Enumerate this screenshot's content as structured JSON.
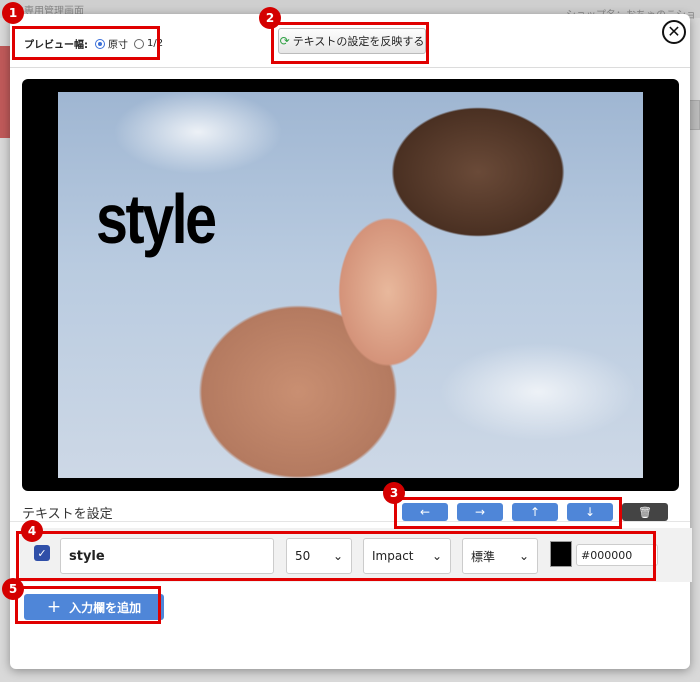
{
  "background": {
    "title": "画像専用管理画面",
    "shop": "ショップ名：おちゃのこショ"
  },
  "header": {
    "preview_label": "プレビュー幅:",
    "option_actual": "原寸",
    "option_half": "1/2",
    "selected": "原寸",
    "apply_label": "テキストの設定を反映する",
    "close_symbol": "✕"
  },
  "preview": {
    "overlay_text": "style"
  },
  "text_settings": {
    "section_label": "テキストを設定",
    "arrows": [
      "←",
      "→",
      "↑",
      "↓"
    ],
    "delete_symbol": "🗑",
    "row": {
      "checked": true,
      "check_symbol": "✓",
      "text_value": "style",
      "size": "50",
      "font": "Impact",
      "weight": "標準",
      "color_hex": "#000000"
    },
    "add_label": "入力欄を追加",
    "add_symbol": "+"
  },
  "annotations": [
    "1",
    "2",
    "3",
    "4",
    "5"
  ],
  "colors": {
    "accent": "#4f86d8",
    "annotation": "#d40000",
    "text_color": "#000000"
  }
}
